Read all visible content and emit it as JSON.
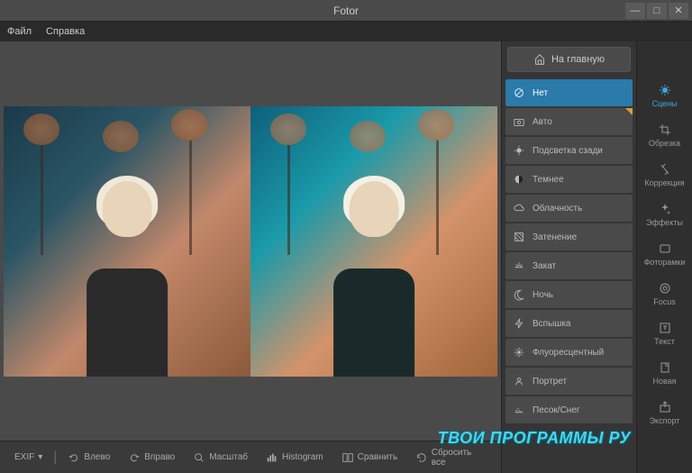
{
  "app_title": "Fotor",
  "menu": {
    "file": "Файл",
    "help": "Справка"
  },
  "home_button": "На главную",
  "scenes": [
    {
      "label": "Нет",
      "icon": "none",
      "active": true
    },
    {
      "label": "Авто",
      "icon": "camera",
      "corner": true
    },
    {
      "label": "Подсветка сзади",
      "icon": "backlight"
    },
    {
      "label": "Темнее",
      "icon": "darken"
    },
    {
      "label": "Облачность",
      "icon": "cloud"
    },
    {
      "label": "Затенение",
      "icon": "shade"
    },
    {
      "label": "Закат",
      "icon": "sunset"
    },
    {
      "label": "Ночь",
      "icon": "night"
    },
    {
      "label": "Вспышка",
      "icon": "flash"
    },
    {
      "label": "Флуоресцентный",
      "icon": "fluorescent"
    },
    {
      "label": "Портрет",
      "icon": "portrait"
    },
    {
      "label": "Песок/Снег",
      "icon": "sand"
    }
  ],
  "tools": [
    {
      "label": "Сцены",
      "icon": "scenes",
      "active": true
    },
    {
      "label": "Обрезка",
      "icon": "crop"
    },
    {
      "label": "Коррекция",
      "icon": "adjust"
    },
    {
      "label": "Эффекты",
      "icon": "effects"
    },
    {
      "label": "Фоторамки",
      "icon": "frames"
    },
    {
      "label": "Focus",
      "icon": "focus"
    },
    {
      "label": "Текст",
      "icon": "text"
    },
    {
      "label": "Новая",
      "icon": "new"
    },
    {
      "label": "Экспорт",
      "icon": "export"
    }
  ],
  "toolbar": {
    "exif": "EXIF",
    "left": "Влево",
    "right": "Вправо",
    "zoom": "Масштаб",
    "histogram": "Histogram",
    "compare": "Сравнить",
    "reset": "Сбросить все"
  },
  "watermark": "ТВОИ ПРОГРАММЫ РУ"
}
